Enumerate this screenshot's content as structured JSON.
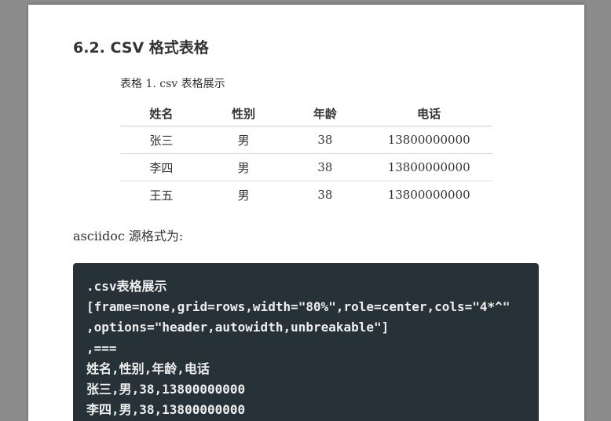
{
  "section": {
    "title": "6.2. CSV 格式表格"
  },
  "table": {
    "caption": "表格 1. csv 表格展示",
    "headers": [
      "姓名",
      "性别",
      "年龄",
      "电话"
    ],
    "rows": [
      [
        "张三",
        "男",
        "38",
        "13800000000"
      ],
      [
        "李四",
        "男",
        "38",
        "13800000000"
      ],
      [
        "王五",
        "男",
        "38",
        "13800000000"
      ]
    ]
  },
  "intro": "asciidoc 源格式为:",
  "code": {
    "lines": [
      ".csv表格展示",
      "[frame=none,grid=rows,width=\"80%\",role=center,cols=\"4*^\"",
      ",options=\"header,autowidth,unbreakable\"]",
      ",===",
      "姓名,性别,年龄,电话",
      "张三,男,38,13800000000",
      "李四,男,38,13800000000"
    ]
  },
  "colors": {
    "code_bg": "#263238",
    "page_bg": "#ffffff",
    "backdrop": "#8c8c8c"
  }
}
